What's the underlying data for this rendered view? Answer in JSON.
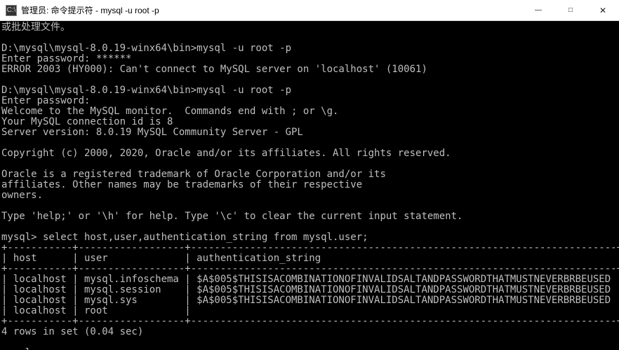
{
  "titlebar": {
    "icon_label": "C:\\",
    "text": "管理员: 命令提示符 - mysql  -u root -p",
    "minimize": "—",
    "maximize": "□",
    "close": "✕"
  },
  "terminal": {
    "lines": [
      "或批处理文件。",
      "",
      "D:\\mysql\\mysql-8.0.19-winx64\\bin>mysql -u root -p",
      "Enter password: ******",
      "ERROR 2003 (HY000): Can't connect to MySQL server on 'localhost' (10061)",
      "",
      "D:\\mysql\\mysql-8.0.19-winx64\\bin>mysql -u root -p",
      "Enter password:",
      "Welcome to the MySQL monitor.  Commands end with ; or \\g.",
      "Your MySQL connection id is 8",
      "Server version: 8.0.19 MySQL Community Server - GPL",
      "",
      "Copyright (c) 2000, 2020, Oracle and/or its affiliates. All rights reserved.",
      "",
      "Oracle is a registered trademark of Oracle Corporation and/or its",
      "affiliates. Other names may be trademarks of their respective",
      "owners.",
      "",
      "Type 'help;' or '\\h' for help. Type '\\c' to clear the current input statement.",
      "",
      "mysql> select host,user,authentication_string from mysql.user;",
      "+-----------+------------------+------------------------------------------------------------------------+",
      "| host      | user             | authentication_string                                                  |",
      "+-----------+------------------+------------------------------------------------------------------------+",
      "| localhost | mysql.infoschema | $A$005$THISISACOMBINATIONOFINVALIDSALTANDPASSWORDTHATMUSTNEVERBRBEUSED |",
      "| localhost | mysql.session    | $A$005$THISISACOMBINATIONOFINVALIDSALTANDPASSWORDTHATMUSTNEVERBRBEUSED |",
      "| localhost | mysql.sys        | $A$005$THISISACOMBINATIONOFINVALIDSALTANDPASSWORDTHATMUSTNEVERBRBEUSED |",
      "| localhost | root             |                                                                        |",
      "+-----------+------------------+------------------------------------------------------------------------+",
      "4 rows in set (0.04 sec)",
      "",
      "mysql>"
    ],
    "table": {
      "columns": [
        "host",
        "user",
        "authentication_string"
      ],
      "rows": [
        [
          "localhost",
          "mysql.infoschema",
          "$A$005$THISISACOMBINATIONOFINVALIDSALTANDPASSWORDTHATMUSTNEVERBRBEUSED"
        ],
        [
          "localhost",
          "mysql.session",
          "$A$005$THISISACOMBINATIONOFINVALIDSALTANDPASSWORDTHATMUSTNEVERBRBEUSED"
        ],
        [
          "localhost",
          "mysql.sys",
          "$A$005$THISISACOMBINATIONOFINVALIDSALTANDPASSWORDTHATMUSTNEVERBRBEUSED"
        ],
        [
          "localhost",
          "root",
          ""
        ]
      ]
    },
    "row_summary": "4 rows in set (0.04 sec)",
    "current_prompt": "mysql>"
  }
}
